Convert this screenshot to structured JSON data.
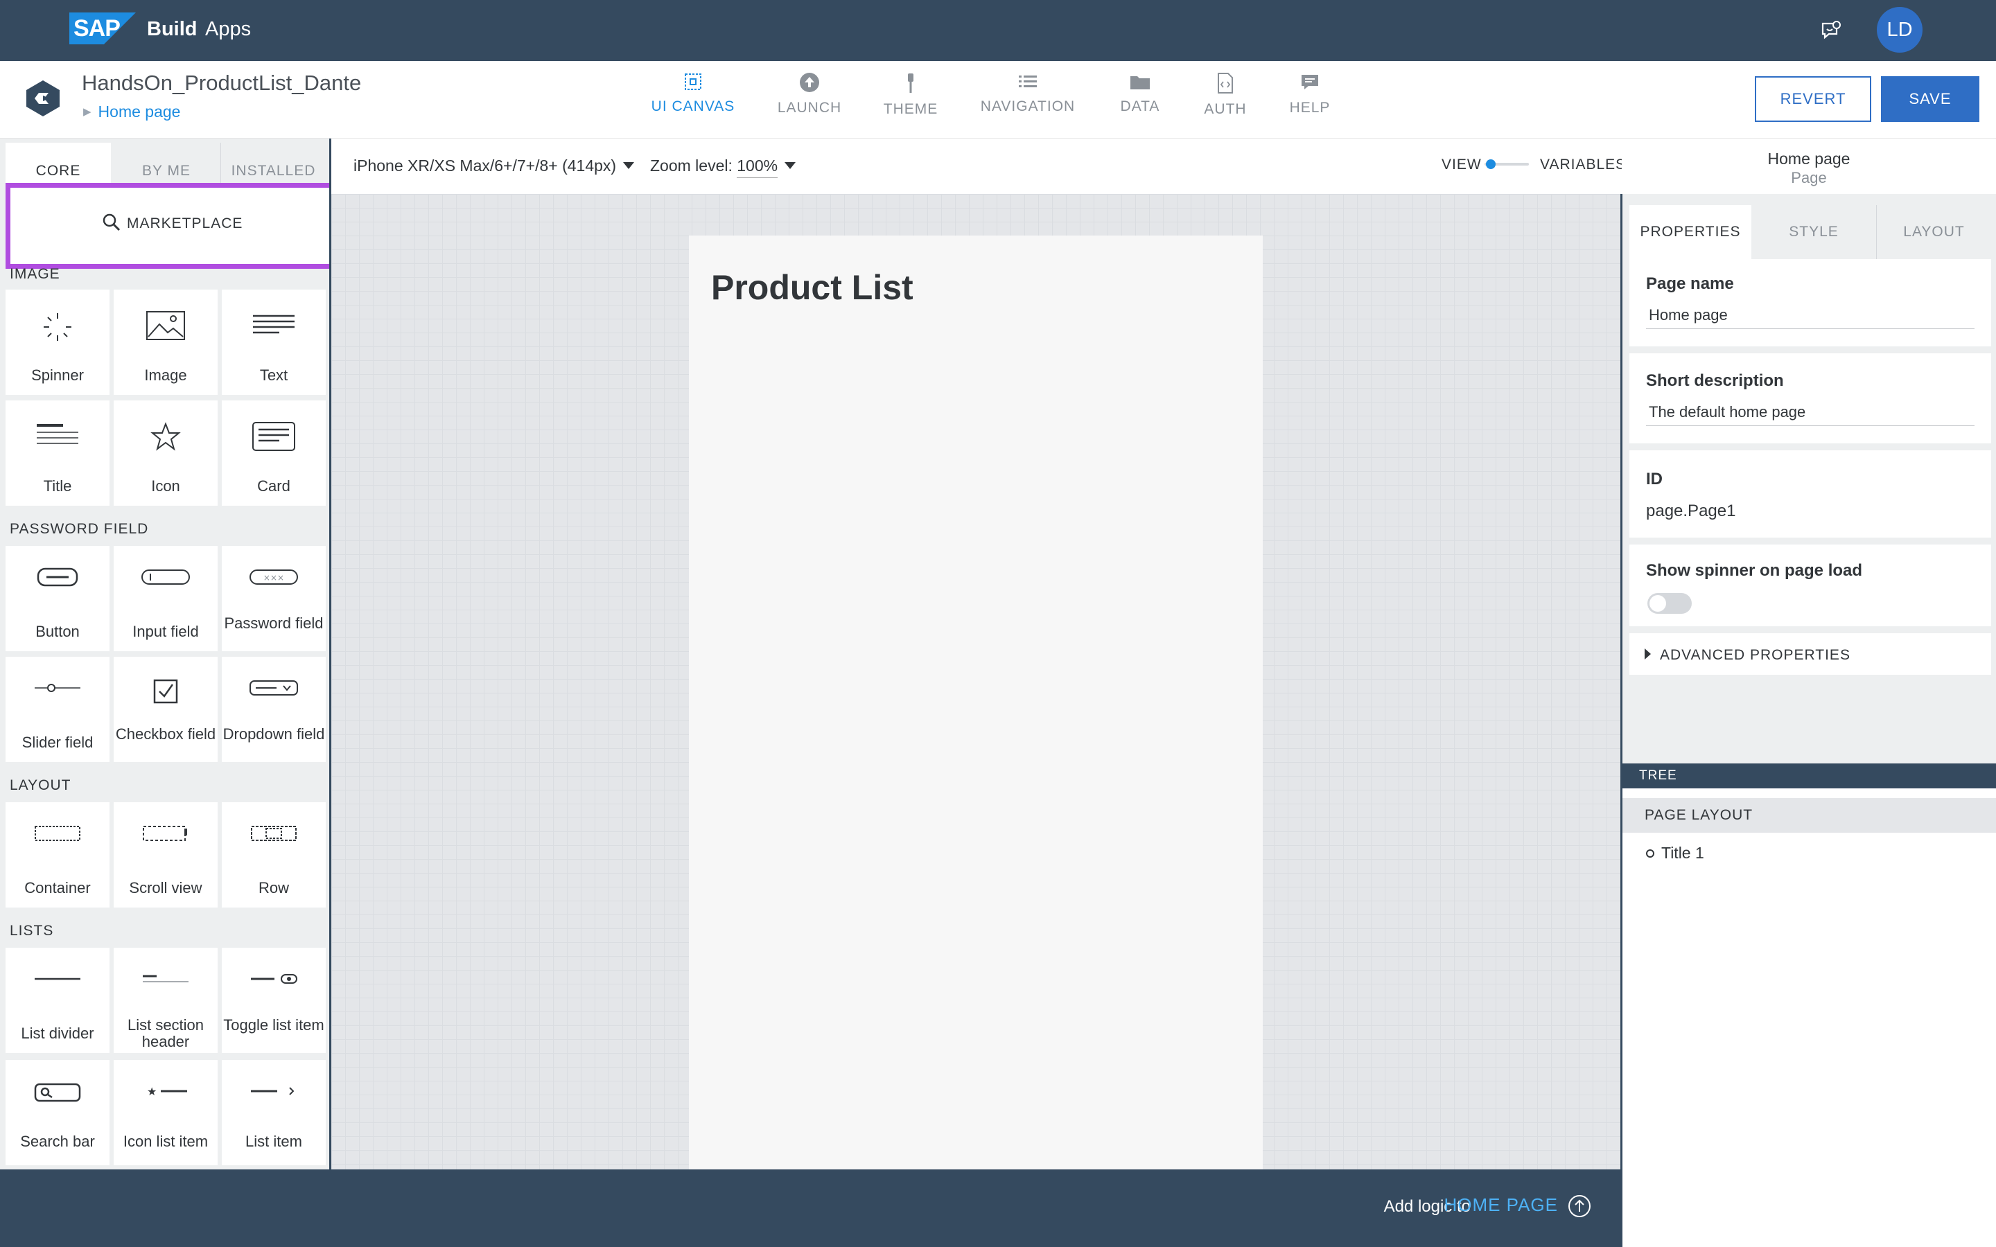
{
  "shell": {
    "brand": "SAP",
    "product_bold": "Build",
    "product": "Apps",
    "avatar_initials": "LD",
    "feedback_icon": "feedback-icon"
  },
  "header": {
    "project_title": "HandsOn_ProductList_Dante",
    "breadcrumb": "Home page",
    "nav": [
      {
        "label": "UI CANVAS",
        "icon": "canvas-icon",
        "active": true
      },
      {
        "label": "LAUNCH",
        "icon": "upload-icon"
      },
      {
        "label": "THEME",
        "icon": "brush-icon"
      },
      {
        "label": "NAVIGATION",
        "icon": "list-icon"
      },
      {
        "label": "DATA",
        "icon": "folder-icon"
      },
      {
        "label": "AUTH",
        "icon": "code-file-icon"
      },
      {
        "label": "HELP",
        "icon": "chat-icon"
      }
    ],
    "revert_label": "REVERT",
    "save_label": "SAVE"
  },
  "left_panel": {
    "tabs": [
      "CORE",
      "BY ME",
      "INSTALLED"
    ],
    "marketplace_label": "MARKETPLACE",
    "sections": [
      "IMAGE",
      "PASSWORD FIELD",
      "LAYOUT",
      "LISTS"
    ],
    "tiles": [
      "Spinner",
      "Image",
      "Text",
      "Title",
      "Icon",
      "Card",
      "Button",
      "Input field",
      "Password field",
      "Slider field",
      "Checkbox field",
      "Dropdown field",
      "Container",
      "Scroll view",
      "Row",
      "List divider",
      "List section header",
      "Toggle list item",
      "Search bar",
      "Icon list item",
      "List item"
    ]
  },
  "toolbar": {
    "device": "iPhone XR/XS Max/6+/7+/8+ (414px)",
    "zoom_label": "Zoom level:",
    "zoom_value": "100%",
    "view_label": "VIEW",
    "variables_label": "VARIABLES"
  },
  "canvas": {
    "page_title": "Product List"
  },
  "right_panel": {
    "header_title": "Home page",
    "header_sub": "Page",
    "tabs": [
      "PROPERTIES",
      "STYLE",
      "LAYOUT"
    ],
    "page_name_label": "Page name",
    "page_name_value": "Home page",
    "short_desc_label": "Short description",
    "short_desc_value": "The default home page",
    "id_label": "ID",
    "id_value": "page.Page1",
    "spinner_label": "Show spinner on page load",
    "spinner_on": false,
    "advanced_label": "ADVANCED PROPERTIES",
    "tree_label": "TREE",
    "page_layout_label": "PAGE LAYOUT",
    "tree_items": [
      "Title 1"
    ]
  },
  "logic_bar": {
    "text": "Add logic to",
    "link": "HOME PAGE"
  },
  "colors": {
    "shell": "#354a5f",
    "accent": "#2f6ec5",
    "link": "#1d8ce0",
    "highlight": "#b04de0"
  }
}
